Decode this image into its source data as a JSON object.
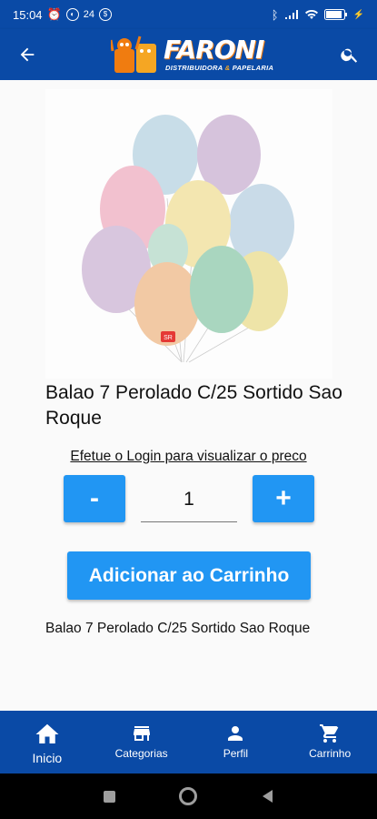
{
  "status_bar": {
    "time": "15:04",
    "notification_badge": "24"
  },
  "app_bar": {
    "back_icon": "arrow-left-icon",
    "search_icon": "search-icon",
    "logo": {
      "name": "FARONI",
      "tagline_part1": "DISTRIBUIDORA",
      "tagline_amp": "&",
      "tagline_part2": "PAPELARIA"
    }
  },
  "product": {
    "title": "Balao 7 Perolado C/25 Sortido Sao Roque",
    "login_prompt": "Efetue o Login para visualizar o preco",
    "quantity": "1",
    "minus_label": "-",
    "plus_label": "+",
    "add_to_cart_label": "Adicionar ao Carrinho",
    "description": "Balao 7 Perolado C/25 Sortido Sao Roque",
    "balloon_brand_badge": "SR"
  },
  "bottom_nav": {
    "items": [
      {
        "label": "Inicio",
        "icon": "home-icon"
      },
      {
        "label": "Categorias",
        "icon": "store-icon"
      },
      {
        "label": "Perfil",
        "icon": "person-icon"
      },
      {
        "label": "Carrinho",
        "icon": "cart-icon"
      }
    ]
  },
  "colors": {
    "primary": "#0a4aa6",
    "accent_button": "#2196f3",
    "logo_orange": "#f07c10"
  }
}
